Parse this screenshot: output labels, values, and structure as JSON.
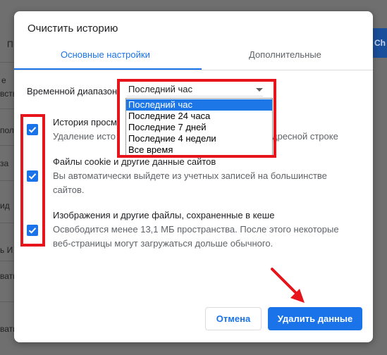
{
  "background": {
    "fragments": [
      "П",
      "е",
      "вства",
      "пол",
      "за",
      "ид",
      "ь И",
      "вать",
      "вать"
    ],
    "right_button": "Ch"
  },
  "dialog": {
    "title": "Очистить историю",
    "tabs": [
      {
        "label": "Основные настройки",
        "active": true
      },
      {
        "label": "Дополнительные",
        "active": false
      }
    ],
    "time_range": {
      "label": "Временной диапазон",
      "selected": "Последний час",
      "options": [
        "Последний час",
        "Последние 24 часа",
        "Последние 7 дней",
        "Последние 4 недели",
        "Все время"
      ]
    },
    "items": [
      {
        "title": "История просм",
        "description": "Удаление исто",
        "description_tail": "дресной строке",
        "checked": true
      },
      {
        "title": "Файлы cookie и другие данные сайтов",
        "description": "Вы автоматически выйдете из учетных записей на большинстве сайтов.",
        "checked": true
      },
      {
        "title": "Изображения и другие файлы, сохраненные в кеше",
        "description": "Освободится менее 13,1 МБ пространства. После этого некоторые веб-страницы могут загружаться дольше обычного.",
        "checked": true
      }
    ],
    "buttons": {
      "cancel": "Отмена",
      "delete": "Удалить данные"
    }
  },
  "colors": {
    "accent": "#1a73e8",
    "annotation": "#e8141b"
  }
}
